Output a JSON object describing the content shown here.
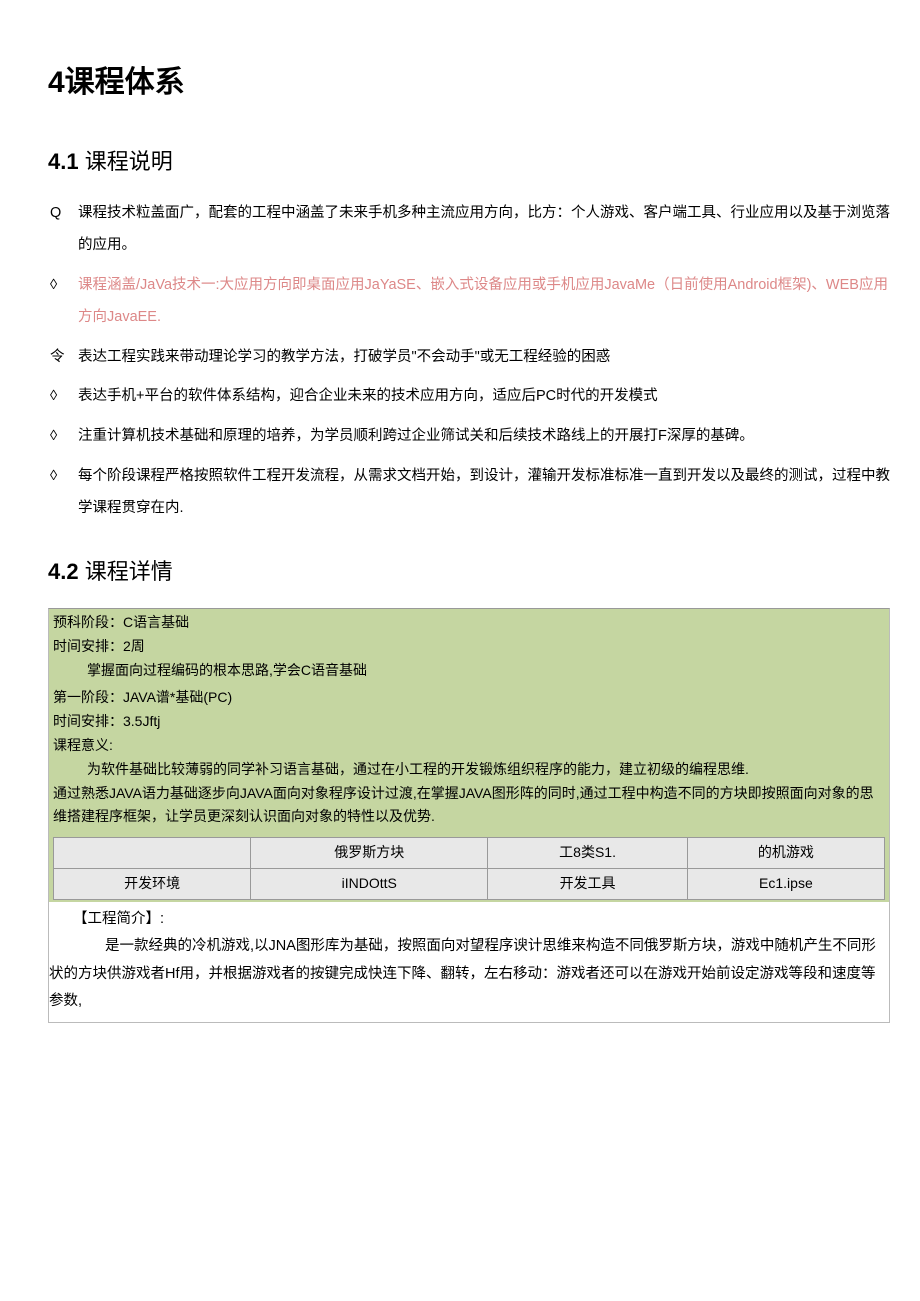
{
  "h1": "4课程体系",
  "h2_1_num": "4.1",
  "h2_1_text": "课程说明",
  "bullets": {
    "b1_sym": "Q",
    "b1": "课程技术粒盖面广，配套的工程中涵盖了未来手机多种主流应用方向，比方：个人游戏、客户端工具、行业应用以及基于浏览落的应用。",
    "b2_sym": "◊",
    "b2": "课程涵盖/JaVa技术一:大应用方向即桌面应用JaYaSE、嵌入式设备应用或手机应用JavaMe（日前使用Android框架)、WEB应用方向JavaEE.",
    "b3_sym": "令",
    "b3": "表达工程实践来带动理论学习的教学方法，打破学员\"不会动手\"或无工程经验的困惑",
    "b4_sym": "◊",
    "b4": "表达手机+平台的软件体系结构，迎合企业未来的技术应用方向，适应后PC时代的开发模式",
    "b5_sym": "◊",
    "b5": "注重计算机技术基础和原理的培养，为学员顺利跨过企业筛试关和后续技术路线上的开展打F深厚的基碑。",
    "b6_sym": "◊",
    "b6": "每个阶段课程严格按照软件工程开发流程，从需求文档开始，到设计，灌输开发标准标准一直到开发以及最终的测试，过程中教学课程贯穿在内."
  },
  "h2_2_num": "4.2",
  "h2_2_text": "课程详情",
  "green1": {
    "l1": "预科阶段：C语言基础",
    "l2": "时间安排：2周",
    "l3": "掌握面向过程编码的根本思路,学会C语音基础"
  },
  "green2": {
    "l1": "第一阶段：JAVA谱*基础(PC)",
    "l2": "时间安排：3.5Jftj",
    "l3": "课程意义:",
    "l4": "为软件基础比较薄弱的同学补习语言基础，通过在小工程的开发锻炼组织程序的能力，建立初级的编程思维.",
    "l5": "通过熟悉JAVA语力基础逐步向JAVA面向对象程序设计过渡,在掌握JAVA图形阵的同时,通过工程中构造不同的方块即按照面向对象的思维搭建程序框架，让学员更深刻认识面向对象的特性以及优势."
  },
  "table": {
    "r1c1": "",
    "r1c2": "俄罗斯方块",
    "r1c3": "工8类S1.",
    "r1c4": "的机游戏",
    "r2c1": "开发环境",
    "r2c2": "iINDOttS",
    "r2c3": "开发工具",
    "r2c4": "Ec1.ipse"
  },
  "proj": {
    "title": "【工程简介】:",
    "body": "是一款经典的冷机游戏,以JNA图形库为基础，按照面向对望程序谀计思维来构造不同俄罗斯方块，游戏中随机产生不同形状的方块供游戏者Hf用，并根据游戏者的按键完成快连下降、翻转，左右移动：游戏者还可以在游戏开始前设定游戏等段和速度等参数,"
  }
}
